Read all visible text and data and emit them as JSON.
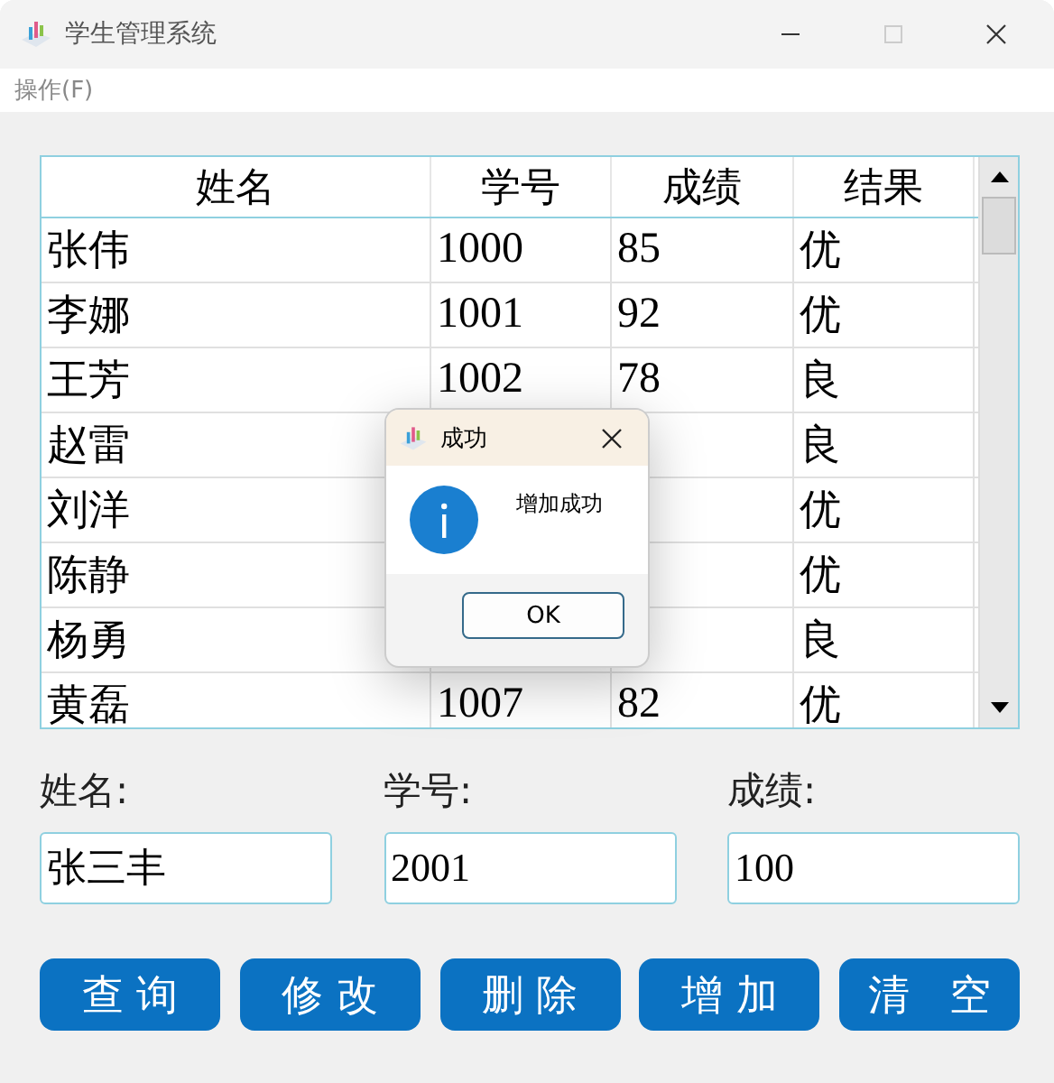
{
  "window": {
    "title": "学生管理系统"
  },
  "menu": [
    "操作(F)"
  ],
  "table": {
    "columns": [
      "姓名",
      "学号",
      "成绩",
      "结果"
    ],
    "rows": [
      {
        "name": "张伟",
        "id": "1000",
        "score": "85",
        "result": "优"
      },
      {
        "name": "李娜",
        "id": "1001",
        "score": "92",
        "result": "优"
      },
      {
        "name": "王芳",
        "id": "1002",
        "score": "78",
        "result": "良"
      },
      {
        "name": "赵雷",
        "result": "良"
      },
      {
        "name": "刘洋",
        "result": "优"
      },
      {
        "name": "陈静",
        "result": "优"
      },
      {
        "name": "杨勇",
        "result": "良"
      },
      {
        "name": "黄磊",
        "id": "1007",
        "score": "82",
        "result": "优"
      }
    ]
  },
  "form": [
    {
      "label": "姓名:",
      "value": "张三丰"
    },
    {
      "label": "学号:",
      "value": "2001"
    },
    {
      "label": "成绩:",
      "value": "100"
    }
  ],
  "buttons": [
    "查 询",
    "修 改",
    "删 除",
    "增 加",
    "清   空"
  ],
  "dialog": {
    "title": "成功",
    "message": "增加成功",
    "button": "OK"
  }
}
